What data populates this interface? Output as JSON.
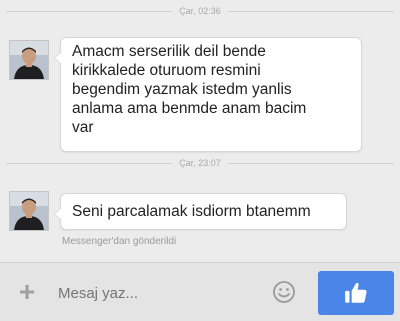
{
  "conversation": {
    "timestamps": [
      "Çar, 02:36",
      "Çar, 23:07"
    ],
    "messages": [
      {
        "lines": [
          "Amacm serserilik deil bende",
          "kirikkalede oturuom resmini",
          "begendim yazmak istedm yanlis",
          "anlama ama benmde anam bacim",
          "var"
        ]
      },
      {
        "lines": [
          "Seni parcalamak isdiorm btanemm"
        ]
      }
    ],
    "sent_from": "Messenger'dan gönderildi"
  },
  "composer": {
    "placeholder": "Mesaj yaz...",
    "icons": {
      "attach": "plus-icon",
      "emoji": "smiley-icon",
      "send": "thumbs-up-icon"
    },
    "accent_color": "#4a86e8"
  }
}
